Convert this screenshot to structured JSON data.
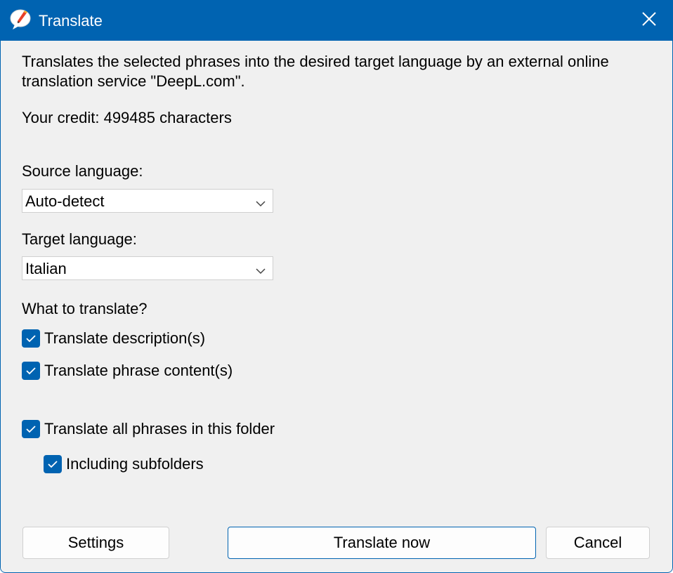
{
  "window": {
    "title": "Translate",
    "accent_color": "#0063b1"
  },
  "description": "Translates the selected phrases into the desired target language by an external online translation service \"DeepL.com\".",
  "credit": "Your credit: 499485 characters",
  "source_language": {
    "label": "Source language:",
    "selected": "Auto-detect"
  },
  "target_language": {
    "label": "Target language:",
    "selected": "Italian"
  },
  "what_to_translate": {
    "heading": "What to translate?",
    "options": [
      {
        "label": "Translate description(s)",
        "checked": true
      },
      {
        "label": "Translate phrase content(s)",
        "checked": true
      }
    ]
  },
  "scope": {
    "all_in_folder": {
      "label": "Translate all phrases in this folder",
      "checked": true
    },
    "subfolders": {
      "label": "Including subfolders",
      "checked": true
    }
  },
  "buttons": {
    "settings": "Settings",
    "translate_now": "Translate now",
    "cancel": "Cancel"
  },
  "icons": {
    "app": "speech-bubble-pen-icon",
    "close": "close-icon",
    "dropdown": "chevron-down-icon",
    "check": "checkmark-icon"
  }
}
